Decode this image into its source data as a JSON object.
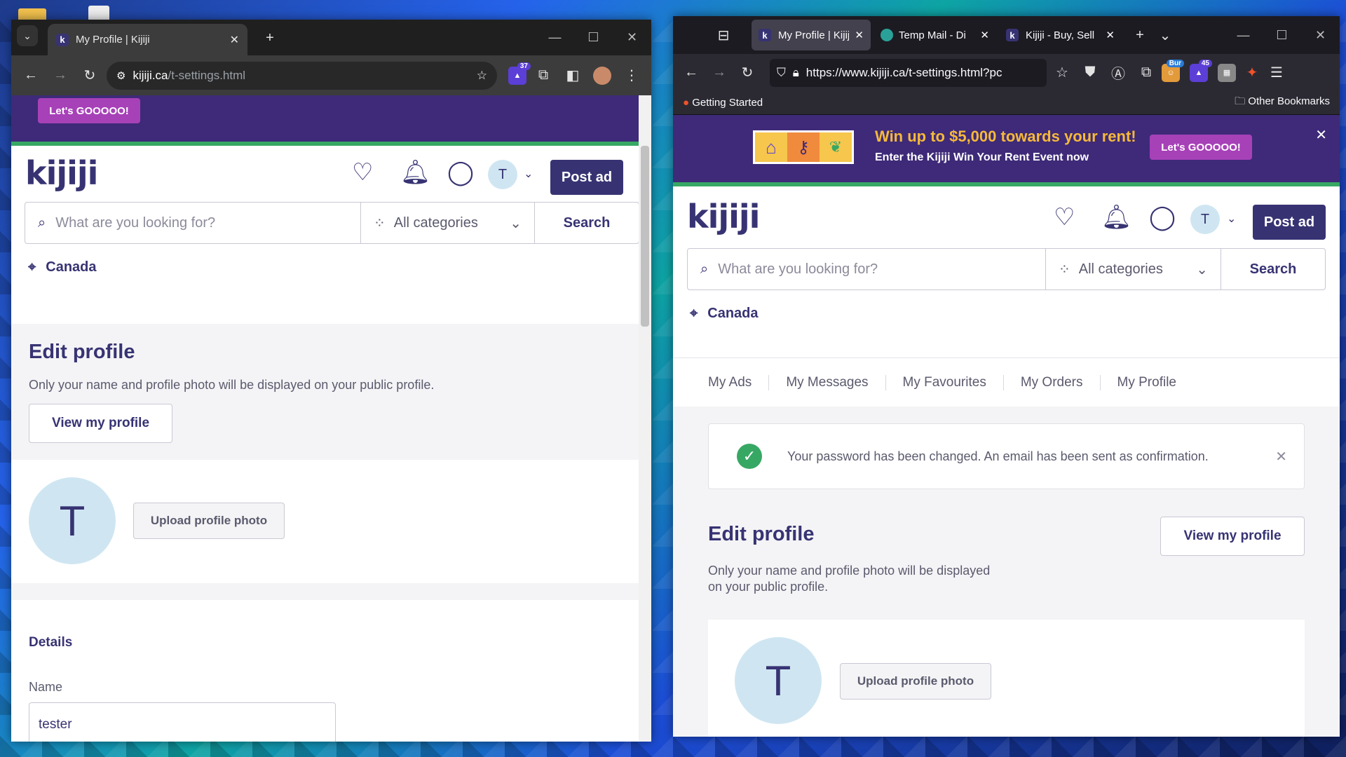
{
  "left": {
    "tab_title": "My Profile | Kijiji",
    "url_host": "kijiji.ca",
    "url_path": "/t-settings.html",
    "ext_badge": "37",
    "promo_button": "Let's GOOOOO!",
    "logo": "kijiji",
    "avatar": "T",
    "post_ad": "Post ad",
    "search_placeholder": "What are you looking for?",
    "category": "All categories",
    "search_button": "Search",
    "location": "Canada",
    "edit_title": "Edit profile",
    "edit_sub": "Only your name and profile photo will be displayed on your public profile.",
    "view_profile": "View my profile",
    "big_avatar": "T",
    "upload": "Upload profile photo",
    "details_title": "Details",
    "name_label": "Name",
    "name_value": "tester"
  },
  "right": {
    "tabs": [
      "My Profile | Kijiji",
      "Temp Mail - Di",
      "Kijiji - Buy, Sell"
    ],
    "url": "https://www.kijiji.ca/t-settings.html?pc",
    "url_host_part": "kijiji.ca",
    "bookmark_left": "Getting Started",
    "bookmark_right": "Other Bookmarks",
    "ext_badges": {
      "bur": "Bur",
      "count": "45"
    },
    "promo_title": "Win up to $5,000 towards your rent!",
    "promo_sub": "Enter the Kijiji Win Your Rent Event now",
    "promo_button": "Let's GOOOOO!",
    "logo": "kijiji",
    "avatar": "T",
    "post_ad": "Post ad",
    "search_placeholder": "What are you looking for?",
    "category": "All categories",
    "search_button": "Search",
    "location": "Canada",
    "nav": [
      "My Ads",
      "My Messages",
      "My Favourites",
      "My Orders",
      "My Profile"
    ],
    "alert": "Your password has been changed. An email has been sent as confirmation.",
    "edit_title": "Edit profile",
    "edit_sub_1": "Only your name and profile photo will be displayed",
    "edit_sub_2": "on your public profile.",
    "view_profile": "View my profile",
    "big_avatar": "T",
    "upload": "Upload profile photo"
  },
  "colors": {
    "brand": "#373373",
    "promo_bg": "#3e2a78",
    "promo_btn": "#a741b8",
    "accent_green": "#37a864",
    "promo_title": "#f6b93b"
  }
}
